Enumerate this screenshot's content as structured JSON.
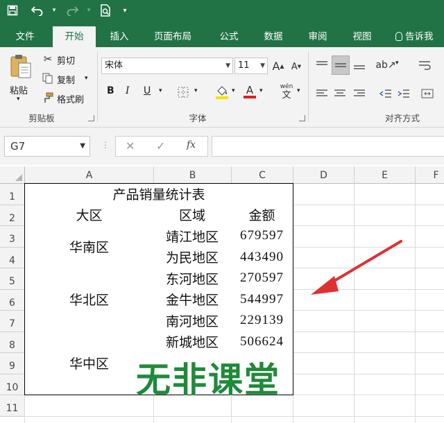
{
  "quick_access": {
    "save_icon": "save-icon",
    "undo_icon": "undo-icon",
    "redo_icon": "redo-icon",
    "preview_icon": "print-preview-icon",
    "customize_icon": "customize-icon"
  },
  "tabs": [
    "文件",
    "开始",
    "插入",
    "页面布局",
    "公式",
    "数据",
    "审阅",
    "视图"
  ],
  "tell_me": "告诉我",
  "clipboard": {
    "paste": "粘贴",
    "cut": "剪切",
    "copy": "复制",
    "format_painter": "格式刷",
    "group": "剪贴板"
  },
  "font": {
    "name": "宋体",
    "size": "11",
    "bold": "B",
    "italic": "I",
    "underline": "U",
    "font_color_letter": "A",
    "wen": "wén",
    "wen_char": "文",
    "group": "字体"
  },
  "alignment": {
    "group": "对齐方式"
  },
  "formula_bar": {
    "name_box": "G7",
    "cancel": "✕",
    "enter": "✓",
    "fx": "fx"
  },
  "columns": [
    "A",
    "B",
    "C",
    "D",
    "E",
    "F"
  ],
  "rows": [
    "1",
    "2",
    "3",
    "4",
    "5",
    "6",
    "7",
    "8",
    "9",
    "10",
    "11"
  ],
  "sheet": {
    "title": "产品销量统计表",
    "headers": {
      "region": "大区",
      "area": "区域",
      "amount": "金额"
    },
    "groups": [
      {
        "region": "华南区",
        "rows": [
          {
            "area": "靖江地区",
            "amount": "679597"
          },
          {
            "area": "为民地区",
            "amount": "443490"
          }
        ]
      },
      {
        "region": "华北区",
        "rows": [
          {
            "area": "东河地区",
            "amount": "270597"
          },
          {
            "area": "金牛地区",
            "amount": "544997"
          },
          {
            "area": "南河地区",
            "amount": "229139"
          }
        ]
      },
      {
        "region": "华中区",
        "rows": [
          {
            "area": "新城地区",
            "amount": "506624"
          },
          {
            "area": "",
            "amount": ""
          },
          {
            "area": "",
            "amount": ""
          }
        ]
      }
    ]
  },
  "watermark": "无非课堂",
  "colors": {
    "accent": "#217346",
    "arrow": "#e03030",
    "watermark": "#1f8a3a"
  }
}
